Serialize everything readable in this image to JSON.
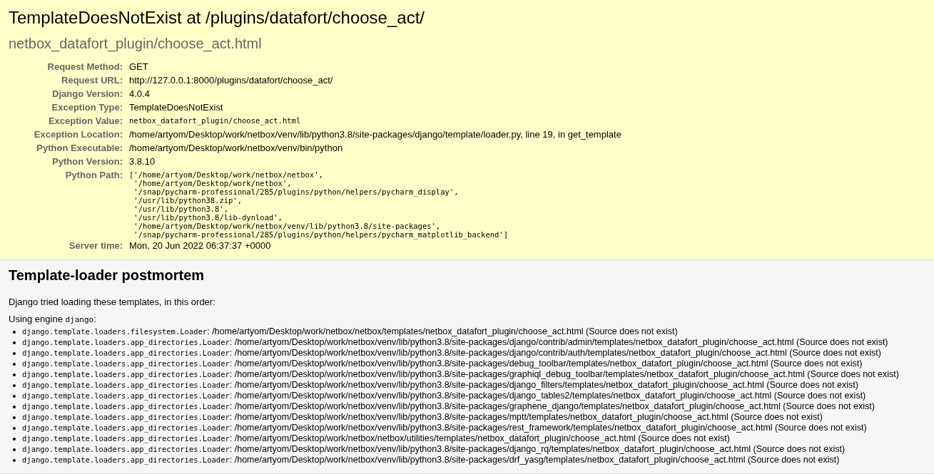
{
  "summary": {
    "title": "TemplateDoesNotExist at /plugins/datafort/choose_act/",
    "subtitle": "netbox_datafort_plugin/choose_act.html",
    "meta": [
      {
        "label": "Request Method:",
        "kind": "text",
        "value": "GET"
      },
      {
        "label": "Request URL:",
        "kind": "text",
        "value": "http://127.0.0.1:8000/plugins/datafort/choose_act/"
      },
      {
        "label": "Django Version:",
        "kind": "text",
        "value": "4.0.4"
      },
      {
        "label": "Exception Type:",
        "kind": "text",
        "value": "TemplateDoesNotExist"
      },
      {
        "label": "Exception Value:",
        "kind": "code",
        "value": "netbox_datafort_plugin/choose_act.html"
      },
      {
        "label": "Exception Location:",
        "kind": "text",
        "value": "/home/artyom/Desktop/work/netbox/venv/lib/python3.8/site-packages/django/template/loader.py, line 19, in get_template"
      },
      {
        "label": "Python Executable:",
        "kind": "text",
        "value": "/home/artyom/Desktop/work/netbox/venv/bin/python"
      },
      {
        "label": "Python Version:",
        "kind": "text",
        "value": "3.8.10"
      },
      {
        "label": "Python Path:",
        "kind": "code",
        "value": "['/home/artyom/Desktop/work/netbox/netbox',\n '/home/artyom/Desktop/work/netbox',\n '/snap/pycharm-professional/285/plugins/python/helpers/pycharm_display',\n '/usr/lib/python38.zip',\n '/usr/lib/python3.8',\n '/usr/lib/python3.8/lib-dynload',\n '/home/artyom/Desktop/work/netbox/venv/lib/python3.8/site-packages',\n '/snap/pycharm-professional/285/plugins/python/helpers/pycharm_matplotlib_backend']"
      },
      {
        "label": "Server time:",
        "kind": "text",
        "value": "Mon, 20 Jun 2022 06:37:37 +0000"
      }
    ]
  },
  "postmortem": {
    "title": "Template-loader postmortem",
    "intro": "Django tried loading these templates, in this order:",
    "engine_line": {
      "prefix": "Using engine ",
      "engine": "django",
      "suffix": ":"
    },
    "attempts": [
      {
        "loader": "django.template.loaders.filesystem.Loader",
        "detail": ": /home/artyom/Desktop/work/netbox/netbox/templates/netbox_datafort_plugin/choose_act.html (Source does not exist)"
      },
      {
        "loader": "django.template.loaders.app_directories.Loader",
        "detail": ": /home/artyom/Desktop/work/netbox/venv/lib/python3.8/site-packages/django/contrib/admin/templates/netbox_datafort_plugin/choose_act.html (Source does not exist)"
      },
      {
        "loader": "django.template.loaders.app_directories.Loader",
        "detail": ": /home/artyom/Desktop/work/netbox/venv/lib/python3.8/site-packages/django/contrib/auth/templates/netbox_datafort_plugin/choose_act.html (Source does not exist)"
      },
      {
        "loader": "django.template.loaders.app_directories.Loader",
        "detail": ": /home/artyom/Desktop/work/netbox/venv/lib/python3.8/site-packages/debug_toolbar/templates/netbox_datafort_plugin/choose_act.html (Source does not exist)"
      },
      {
        "loader": "django.template.loaders.app_directories.Loader",
        "detail": ": /home/artyom/Desktop/work/netbox/venv/lib/python3.8/site-packages/graphiql_debug_toolbar/templates/netbox_datafort_plugin/choose_act.html (Source does not exist)"
      },
      {
        "loader": "django.template.loaders.app_directories.Loader",
        "detail": ": /home/artyom/Desktop/work/netbox/venv/lib/python3.8/site-packages/django_filters/templates/netbox_datafort_plugin/choose_act.html (Source does not exist)"
      },
      {
        "loader": "django.template.loaders.app_directories.Loader",
        "detail": ": /home/artyom/Desktop/work/netbox/venv/lib/python3.8/site-packages/django_tables2/templates/netbox_datafort_plugin/choose_act.html (Source does not exist)"
      },
      {
        "loader": "django.template.loaders.app_directories.Loader",
        "detail": ": /home/artyom/Desktop/work/netbox/venv/lib/python3.8/site-packages/graphene_django/templates/netbox_datafort_plugin/choose_act.html (Source does not exist)"
      },
      {
        "loader": "django.template.loaders.app_directories.Loader",
        "detail": ": /home/artyom/Desktop/work/netbox/venv/lib/python3.8/site-packages/mptt/templates/netbox_datafort_plugin/choose_act.html (Source does not exist)"
      },
      {
        "loader": "django.template.loaders.app_directories.Loader",
        "detail": ": /home/artyom/Desktop/work/netbox/venv/lib/python3.8/site-packages/rest_framework/templates/netbox_datafort_plugin/choose_act.html (Source does not exist)"
      },
      {
        "loader": "django.template.loaders.app_directories.Loader",
        "detail": ": /home/artyom/Desktop/work/netbox/netbox/utilities/templates/netbox_datafort_plugin/choose_act.html (Source does not exist)"
      },
      {
        "loader": "django.template.loaders.app_directories.Loader",
        "detail": ": /home/artyom/Desktop/work/netbox/venv/lib/python3.8/site-packages/django_rq/templates/netbox_datafort_plugin/choose_act.html (Source does not exist)"
      },
      {
        "loader": "django.template.loaders.app_directories.Loader",
        "detail": ": /home/artyom/Desktop/work/netbox/venv/lib/python3.8/site-packages/drf_yasg/templates/netbox_datafort_plugin/choose_act.html (Source does not exist)"
      }
    ]
  }
}
